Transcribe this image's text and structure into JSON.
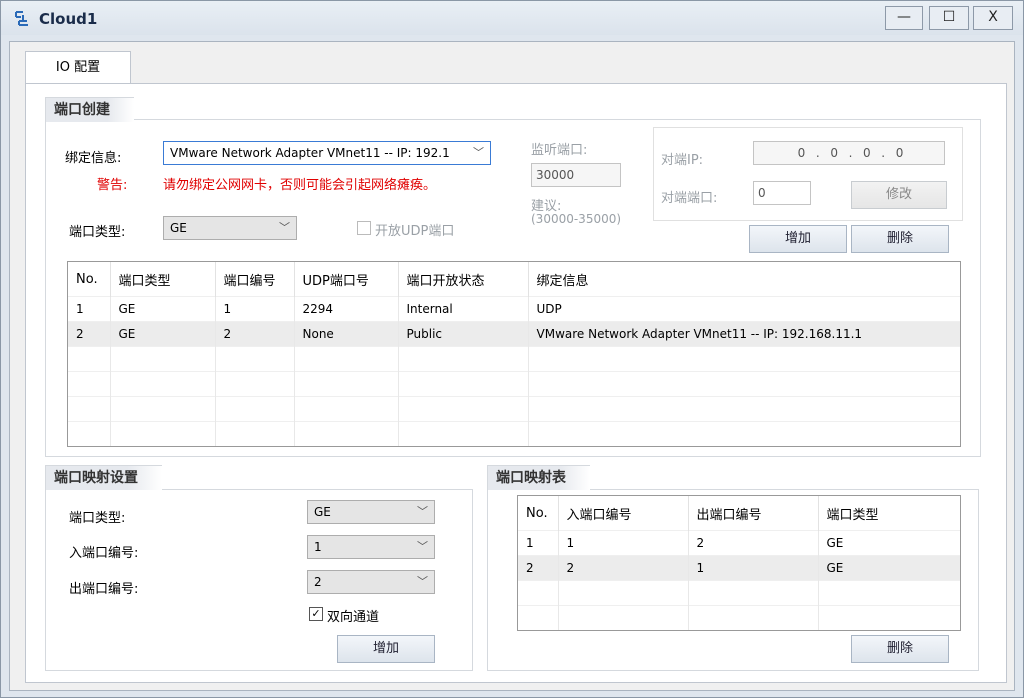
{
  "window": {
    "title": "Cloud1",
    "minimize_glyph": "—",
    "maximize_glyph": "☐",
    "close_glyph": "X"
  },
  "tab": {
    "label": "IO 配置"
  },
  "port_create": {
    "group_title": "端口创建",
    "bind_label": "绑定信息:",
    "bind_value": "VMware Network Adapter VMnet11 -- IP: 192.1",
    "warning_label": "警告:",
    "warning_text": "请勿绑定公网网卡，否则可能会引起网络瘫痪。",
    "port_type_label": "端口类型:",
    "port_type_value": "GE",
    "udp_open_label": "开放UDP端口",
    "listen_port_label": "监听端口:",
    "listen_port_value": "30000",
    "suggest_label": "建议:",
    "suggest_range": "(30000-35000)",
    "peer_ip_label": "对端IP:",
    "peer_ip_parts": [
      "0",
      "0",
      "0",
      "0"
    ],
    "peer_port_label": "对端端口:",
    "peer_port_value": "0",
    "modify_button": "修改",
    "add_button": "增加",
    "delete_button": "删除",
    "table": {
      "headers": [
        "No.",
        "端口类型",
        "端口编号",
        "UDP端口号",
        "端口开放状态",
        "绑定信息"
      ],
      "rows": [
        [
          "1",
          "GE",
          "1",
          "2294",
          "Internal",
          "UDP"
        ],
        [
          "2",
          "GE",
          "2",
          "None",
          "Public",
          "VMware Network Adapter VMnet11 -- IP: 192.168.11.1"
        ]
      ]
    }
  },
  "port_map_settings": {
    "group_title": "端口映射设置",
    "port_type_label": "端口类型:",
    "port_type_value": "GE",
    "in_port_label": "入端口编号:",
    "in_port_value": "1",
    "out_port_label": "出端口编号:",
    "out_port_value": "2",
    "bidirectional_label": "双向通道",
    "bidirectional_checked": true,
    "add_button": "增加"
  },
  "port_map_table": {
    "group_title": "端口映射表",
    "headers": [
      "No.",
      "入端口编号",
      "出端口编号",
      "端口类型"
    ],
    "rows": [
      [
        "1",
        "1",
        "2",
        "GE"
      ],
      [
        "2",
        "2",
        "1",
        "GE"
      ]
    ],
    "delete_button": "删除"
  },
  "colors": {
    "warning": "#e00000",
    "focus_border": "#3a7bd5",
    "title_text": "#1a2c4a"
  }
}
